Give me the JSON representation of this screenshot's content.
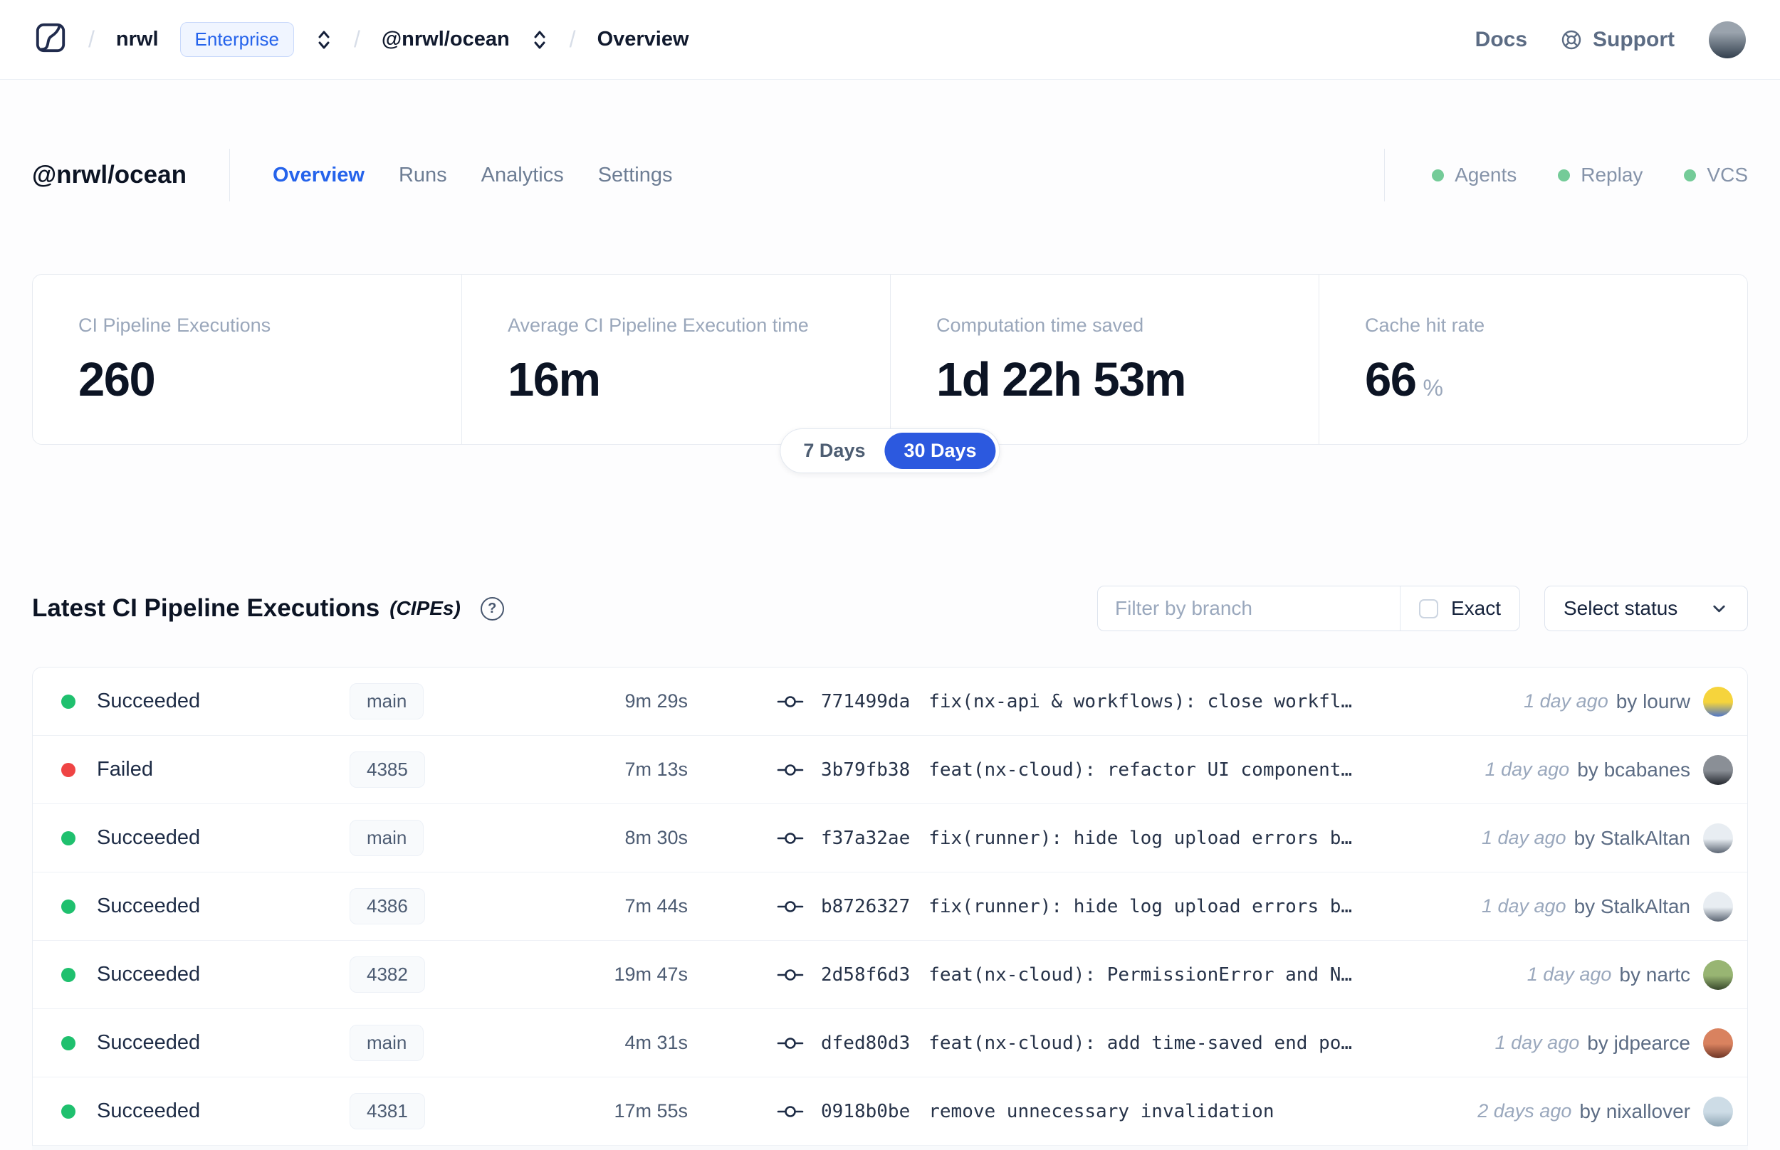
{
  "colors": {
    "accent_blue": "#2c59df",
    "link_blue": "#2563eb",
    "success_green": "#1fc06e",
    "failed_red": "#ef4444",
    "header_dot_green": "#74cb98"
  },
  "navbar": {
    "breadcrumb": {
      "org": "nrwl",
      "org_badge": "Enterprise",
      "workspace": "@nrwl/ocean",
      "page": "Overview"
    },
    "links": {
      "docs": "Docs",
      "support": "Support"
    }
  },
  "header": {
    "workspace": "@nrwl/ocean",
    "tabs": [
      {
        "label": "Overview",
        "active": true
      },
      {
        "label": "Runs",
        "active": false
      },
      {
        "label": "Analytics",
        "active": false
      },
      {
        "label": "Settings",
        "active": false
      }
    ],
    "statuses": [
      "Agents",
      "Replay",
      "VCS"
    ]
  },
  "stats": {
    "periods": [
      {
        "label": "7 Days",
        "active": false
      },
      {
        "label": "30 Days",
        "active": true
      }
    ],
    "cards": [
      {
        "label": "CI Pipeline Executions",
        "value": "260"
      },
      {
        "label": "Average CI Pipeline Execution time",
        "value": "16m"
      },
      {
        "label": "Computation time saved",
        "value": "1d 22h 53m"
      },
      {
        "label": "Cache hit rate",
        "value": "66",
        "unit": "%"
      }
    ]
  },
  "cipes": {
    "title": "Latest CI Pipeline Executions",
    "title_suffix": "(CIPEs)",
    "help_glyph": "?",
    "filter_placeholder": "Filter by branch",
    "exact_label": "Exact",
    "status_select_label": "Select status",
    "by_label": "by",
    "rows": [
      {
        "status": "Succeeded",
        "branch": "main",
        "duration": "9m 29s",
        "commit_hash": "771499da",
        "commit_message": "fix(nx-api & workflows): close workfl…",
        "time": "1 day ago",
        "author": "lourw",
        "avatar_colors": [
          "#f6d43c",
          "#4f76c7"
        ]
      },
      {
        "status": "Failed",
        "branch": "4385",
        "duration": "7m 13s",
        "commit_hash": "3b79fb38",
        "commit_message": "feat(nx-cloud): refactor UI component…",
        "time": "1 day ago",
        "author": "bcabanes",
        "avatar_colors": [
          "#8a8f96",
          "#23272e"
        ]
      },
      {
        "status": "Succeeded",
        "branch": "main",
        "duration": "8m 30s",
        "commit_hash": "f37a32ae",
        "commit_message": "fix(runner): hide log upload errors b…",
        "time": "1 day ago",
        "author": "StalkAltan",
        "avatar_colors": [
          "#e8edf2",
          "#5a6472"
        ]
      },
      {
        "status": "Succeeded",
        "branch": "4386",
        "duration": "7m 44s",
        "commit_hash": "b8726327",
        "commit_message": "fix(runner): hide log upload errors b…",
        "time": "1 day ago",
        "author": "StalkAltan",
        "avatar_colors": [
          "#e8edf2",
          "#5a6472"
        ]
      },
      {
        "status": "Succeeded",
        "branch": "4382",
        "duration": "19m 47s",
        "commit_hash": "2d58f6d3",
        "commit_message": "feat(nx-cloud): PermissionError and N…",
        "time": "1 day ago",
        "author": "nartc",
        "avatar_colors": [
          "#98b573",
          "#394a2c"
        ]
      },
      {
        "status": "Succeeded",
        "branch": "main",
        "duration": "4m 31s",
        "commit_hash": "dfed80d3",
        "commit_message": "feat(nx-cloud): add time-saved end po…",
        "time": "1 day ago",
        "author": "jdpearce",
        "avatar_colors": [
          "#d9825f",
          "#6e3526"
        ]
      },
      {
        "status": "Succeeded",
        "branch": "4381",
        "duration": "17m 55s",
        "commit_hash": "0918b0be",
        "commit_message": "remove unnecessary invalidation",
        "time": "2 days ago",
        "author": "nixallover",
        "avatar_colors": [
          "#cddce6",
          "#8fa6b5"
        ]
      }
    ]
  }
}
